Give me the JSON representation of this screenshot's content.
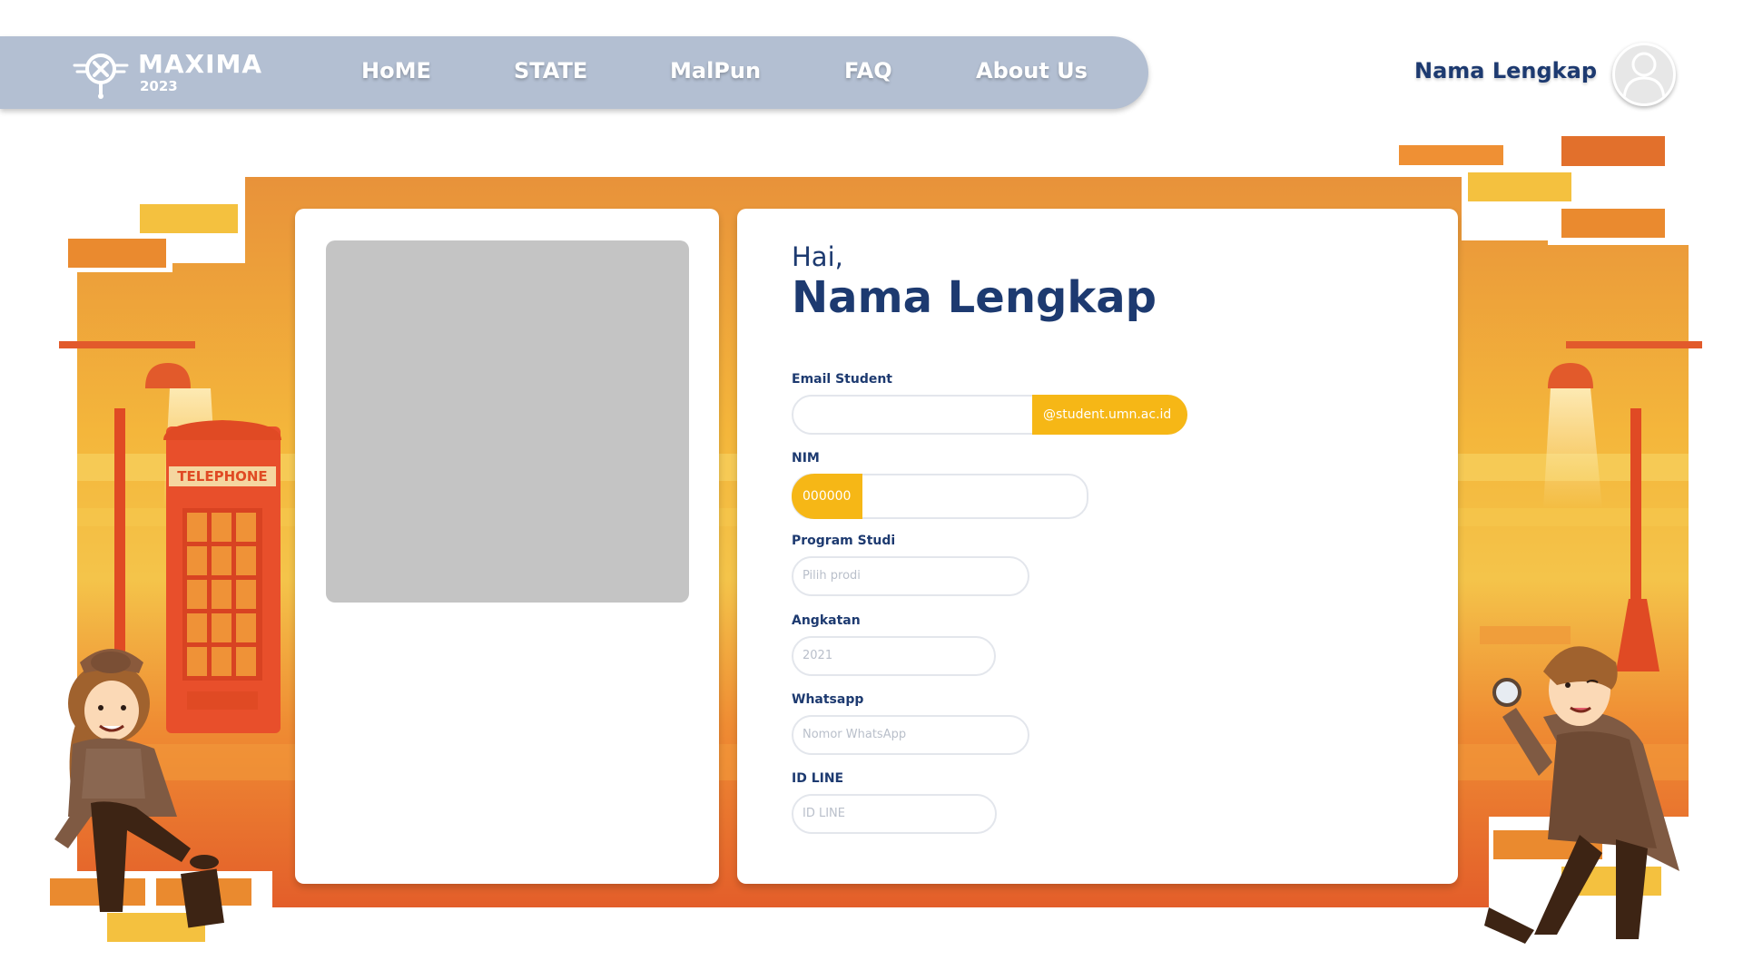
{
  "brand": {
    "title": "MAXIMA",
    "year": "2023"
  },
  "nav": {
    "items": [
      {
        "label": "HoME"
      },
      {
        "label": "STATE"
      },
      {
        "label": "MalPun"
      },
      {
        "label": "FAQ"
      },
      {
        "label": "About Us"
      }
    ]
  },
  "user": {
    "name": "Nama Lengkap"
  },
  "scene": {
    "booth_sign": "TELEPHONE"
  },
  "profile": {
    "greeting": "Hai,",
    "full_name": "Nama Lengkap"
  },
  "form": {
    "email": {
      "label": "Email Student",
      "value": "",
      "suffix": "@student.umn.ac.id"
    },
    "nim": {
      "label": "NIM",
      "prefix": "000000",
      "value": ""
    },
    "program": {
      "label": "Program Studi",
      "placeholder": "Pilih prodi"
    },
    "angkatan": {
      "label": "Angkatan",
      "placeholder": "2021"
    },
    "whatsapp": {
      "label": "Whatsapp",
      "placeholder": "Nomor WhatsApp"
    },
    "line": {
      "label": "ID LINE",
      "placeholder": "ID LINE"
    }
  },
  "colors": {
    "nav_bg": "#b3bfd2",
    "accent_yellow": "#f6b716",
    "navy": "#1d3a70",
    "orange": "#e8862f"
  }
}
